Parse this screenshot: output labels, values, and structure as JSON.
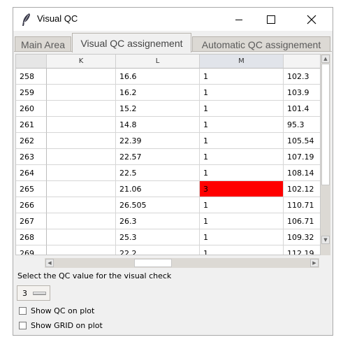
{
  "window": {
    "title": "Visual QC"
  },
  "titlebar_buttons": {
    "minimize": "minimize-icon",
    "maximize": "maximize-icon",
    "close": "close-icon"
  },
  "tabs": [
    {
      "label": "Main Area"
    },
    {
      "label": "Visual QC assignement"
    },
    {
      "label": "Automatic QC assignement"
    }
  ],
  "active_tab": "Visual QC assignement",
  "table": {
    "columns": [
      "K",
      "L",
      "M",
      ""
    ],
    "selected_column": "M",
    "rows": [
      {
        "index": "258",
        "cells": [
          "",
          "16.6",
          "1",
          "102.3"
        ]
      },
      {
        "index": "259",
        "cells": [
          "",
          "16.2",
          "1",
          "103.9"
        ]
      },
      {
        "index": "260",
        "cells": [
          "",
          "15.2",
          "1",
          "101.4"
        ]
      },
      {
        "index": "261",
        "cells": [
          "",
          "14.8",
          "1",
          "95.3"
        ]
      },
      {
        "index": "262",
        "cells": [
          "",
          "22.39",
          "1",
          "105.54"
        ]
      },
      {
        "index": "263",
        "cells": [
          "",
          "22.57",
          "1",
          "107.19"
        ]
      },
      {
        "index": "264",
        "cells": [
          "",
          "22.5",
          "1",
          "108.14"
        ]
      },
      {
        "index": "265",
        "cells": [
          "",
          "21.06",
          "3",
          "102.12"
        ]
      },
      {
        "index": "266",
        "cells": [
          "",
          "26.505",
          "1",
          "110.71"
        ]
      },
      {
        "index": "267",
        "cells": [
          "",
          "26.3",
          "1",
          "106.71"
        ]
      },
      {
        "index": "268",
        "cells": [
          "",
          "25.3",
          "1",
          "109.32"
        ]
      },
      {
        "index": "269",
        "cells": [
          "",
          "22.2",
          "1",
          "112.19"
        ]
      }
    ],
    "flagged_cell": {
      "row": "265",
      "column": "M",
      "color": "#ff0000"
    }
  },
  "qc": {
    "select_label": "Select the QC value for the visual check",
    "selected_value": "3"
  },
  "options": {
    "show_qc_label": "Show QC on plot",
    "show_qc_checked": false,
    "show_grid_label": "Show GRID on plot",
    "show_grid_checked": false
  },
  "colors": {
    "flag": "#ff0000",
    "tab_active": "#f0f0f0",
    "tab_inactive": "#dcd9d4"
  }
}
